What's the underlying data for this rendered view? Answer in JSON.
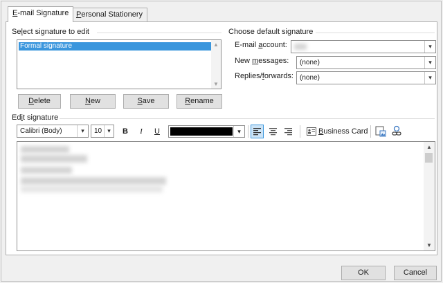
{
  "tabs": [
    {
      "label": "E-mail Signature",
      "underline": "E",
      "active": true
    },
    {
      "label": "Personal Stationery",
      "underline": "P",
      "active": false
    }
  ],
  "select_signature": {
    "group_label": "Select signature to edit",
    "items": [
      "Formal signature"
    ],
    "selected_index": 0
  },
  "signature_buttons": {
    "delete": "Delete",
    "new": "New",
    "save": "Save",
    "rename": "Rename"
  },
  "default_signature": {
    "group_label": "Choose default signature",
    "email_account_label": "E-mail account:",
    "email_account_value": "",
    "new_messages_label": "New messages:",
    "new_messages_value": "(none)",
    "replies_label": "Replies/forwards:",
    "replies_value": "(none)"
  },
  "edit_signature": {
    "group_label": "Edit signature",
    "font": "Calibri (Body)",
    "size": "10",
    "bold": "B",
    "italic": "I",
    "underline": "U",
    "font_color": "#000000",
    "business_card": "Business Card",
    "align_left_active": true
  },
  "footer": {
    "ok": "OK",
    "cancel": "Cancel"
  },
  "colors": {
    "accent": "#3a96dd",
    "panel_bg": "#ffffff",
    "dialog_bg": "#f0f0f0"
  }
}
